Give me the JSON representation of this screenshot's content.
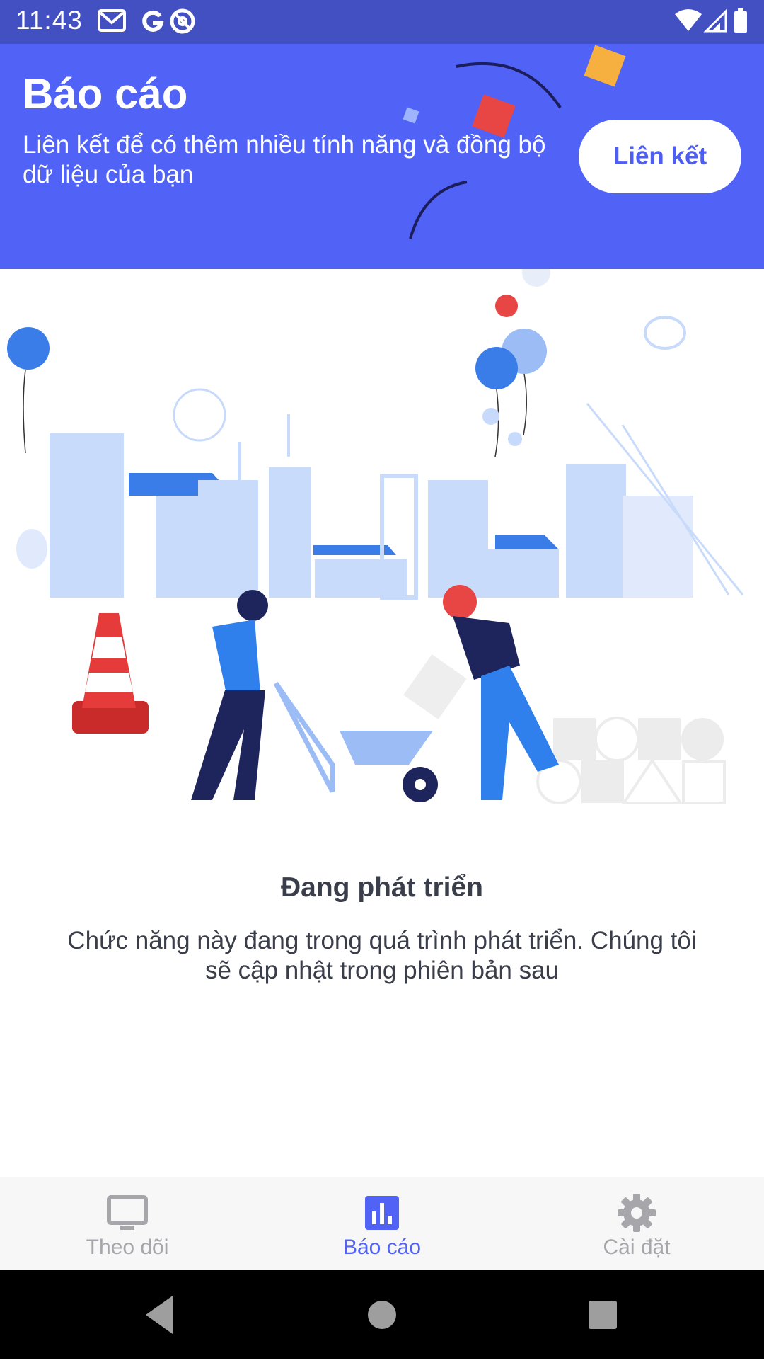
{
  "status_bar": {
    "time": "11:43",
    "left_icons": [
      "gmail-icon",
      "google-icon",
      "at-sign-icon"
    ],
    "right_icons": [
      "wifi-icon",
      "signal-icon",
      "battery-icon"
    ]
  },
  "header": {
    "title": "Báo cáo",
    "subtitle": "Liên kết để có thêm nhiều tính năng và đồng bộ dữ liệu của bạn",
    "link_button_label": "Liên kết",
    "background_color": "#5063f6"
  },
  "illustration": {
    "icon": "construction-city-illustration"
  },
  "empty_state": {
    "title": "Đang phát triển",
    "description": "Chức năng này đang trong quá trình phát triển. Chúng tôi sẽ cập nhật trong phiên bản sau"
  },
  "bottom_nav": {
    "items": [
      {
        "label": "Theo dõi",
        "icon": "monitor-icon",
        "active": false
      },
      {
        "label": "Báo cáo",
        "icon": "bar-chart-icon",
        "active": true
      },
      {
        "label": "Cài đặt",
        "icon": "gear-icon",
        "active": false
      }
    ],
    "active_color": "#5063f6",
    "inactive_color": "#a6a6ab"
  },
  "system_nav": {
    "buttons": [
      "back-icon",
      "home-icon",
      "recents-icon"
    ]
  }
}
